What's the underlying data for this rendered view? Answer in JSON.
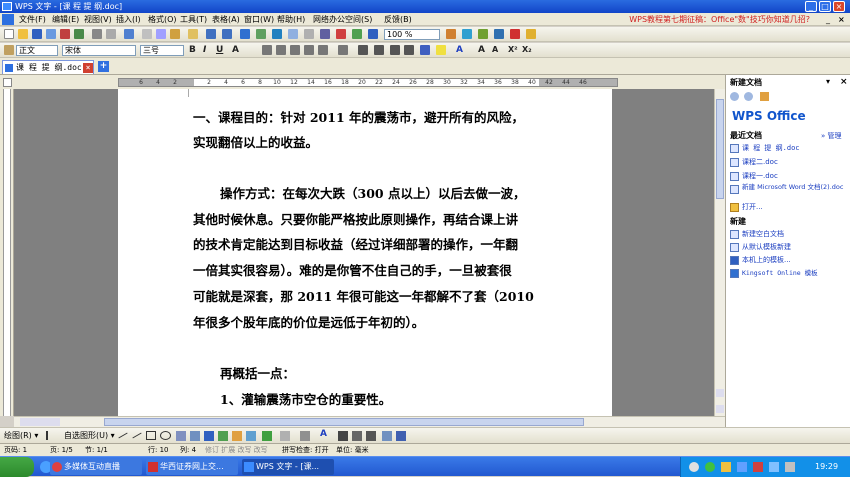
{
  "window": {
    "title": "WPS 文字 - [课 程 提 纲.doc]"
  },
  "menu": {
    "items": [
      "文件(F)",
      "编辑(E)",
      "视图(V)",
      "插入(I)",
      "格式(O)",
      "工具(T)",
      "表格(A)",
      "窗口(W)",
      "帮助(H)",
      "网络办公空间(S)",
      "反馈(B)"
    ],
    "promo": "WPS教程第七期征稿：Office\"数\"技巧你知道几招?"
  },
  "format_toolbar": {
    "style": "正文",
    "font": "宋体",
    "size": "三号",
    "zoom": "100 %"
  },
  "doc_tab": {
    "name": "课 程 提 纲.doc"
  },
  "ruler": {
    "ticks": [
      "6",
      "4",
      "2",
      "2",
      "4",
      "6",
      "8",
      "10",
      "12",
      "14",
      "16",
      "18",
      "20",
      "22",
      "24",
      "26",
      "28",
      "30",
      "32",
      "34",
      "36",
      "38",
      "40",
      "42",
      "44",
      "46"
    ]
  },
  "document": {
    "lines": [
      "一、课程目的：针对 2011 年的震荡市，避开所有的风险，",
      "实现翻倍以上的收益。",
      "操作方式：在每次大跌（300 点以上）以后去做一波，",
      "其他时候休息。只要你能严格按此原则操作，再结合课上讲",
      "的技术肯定能达到目标收益（经过详细部署的操作，一年翻",
      "一倍其实很容易）。难的是你管不住自己的手，一旦被套很",
      "可能就是深套，那 2011 年很可能这一年都解不了套（2010",
      "年很多个股年底的价位是远低于年初的）。",
      "再概括一点：",
      "1、灌输震荡市空仓的重要性。"
    ]
  },
  "task_pane": {
    "title": "新建文档",
    "logo": "WPS Office",
    "recent_header": "最近文档",
    "more": "» 管理",
    "recent": [
      "课 程 提 纲.doc",
      "课程二.doc",
      "课程一.doc",
      "新建 Microsoft Word 文档(2).doc",
      "打开..."
    ],
    "new_header": "新建",
    "new_items": [
      "新建空白文档",
      "从默认模板新建",
      "本机上的模板...",
      "Kingsoft Online 模板"
    ]
  },
  "draw_toolbar": {
    "draw_label": "绘图(R) ▾",
    "autoshape_label": "自选图形(U) ▾"
  },
  "status_bar": {
    "page": "页码: 1",
    "section": "节: 1/1",
    "pages": "页: 1/5",
    "pos_section": "节: 1/1",
    "row": "行: 10",
    "col": "列: 4",
    "modes": "修订  扩展  改写  改写",
    "spell": "拼写检查: 打开",
    "unit": "单位: 毫米"
  },
  "taskbar": {
    "tasks": [
      "多媒体互动直播",
      "华西证券网上交...",
      "WPS 文字 - [课..."
    ],
    "time": "19:29"
  }
}
